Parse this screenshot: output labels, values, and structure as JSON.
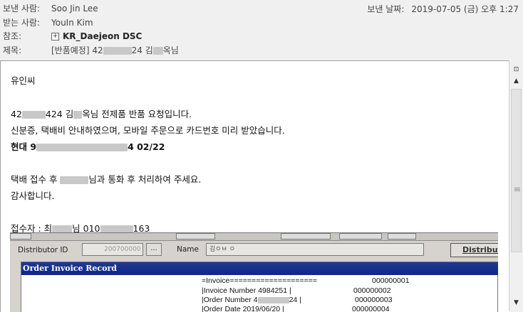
{
  "header": {
    "from_label": "보낸 사람:",
    "from_value": "Soo Jin Lee",
    "to_label": "받는 사람:",
    "to_value": "YouIn Kim",
    "cc_label": "참조:",
    "cc_expand_icon": "plus-box-icon",
    "cc_value": "KR_Daejeon DSC",
    "subject_label": "제목:",
    "subject_part1": "[반품예정] 42",
    "subject_part2": "24 김",
    "subject_part3": "옥님",
    "sent_label": "보낸 날짜:",
    "sent_value": "2019-07-05 (금) 오후 1:27"
  },
  "body": {
    "greeting": "유인씨",
    "line1_a": "42",
    "line1_b": "424 김",
    "line1_c": "옥님 전제품 반품 요청입니다.",
    "line2": "신분증, 택배비 안내하였으며, 모바일 주문으로 카드번호 미리 받았습니다.",
    "line3_a": "현대 9",
    "line3_b": "4  02/22",
    "line4_a": "택배 접수 후 ",
    "line4_b": "님과 통화 후 처리하여 주세요.",
    "line5": "감사합니다.",
    "line6_a": "접수자 : 최",
    "line6_b": "님 010",
    "line6_c": "163"
  },
  "attachment": {
    "distributor_label": "Distributor ID",
    "distributor_value": "200700000",
    "browse_btn": "...",
    "name_label": "Name",
    "name_value": "김ㅇㅂ ㅇ",
    "distributor_btn": "Distributo",
    "panel_title": "Order Invoice Record",
    "inv_header": "=Invoice====================",
    "inv_header_code": "000000001",
    "inv_number_label": "|Invoice Number   4984251 |",
    "inv_number_code": "000000002",
    "order_number_label_a": "|Order Number    4",
    "order_number_label_b": "24 |",
    "order_number_code": "000000003",
    "order_date_label": "|Order Date     2019/06/20 |",
    "order_date_code": "000000004"
  },
  "scrollbar": {
    "up_icon": "arrow-up-icon",
    "down_icon": "arrow-down-icon"
  }
}
